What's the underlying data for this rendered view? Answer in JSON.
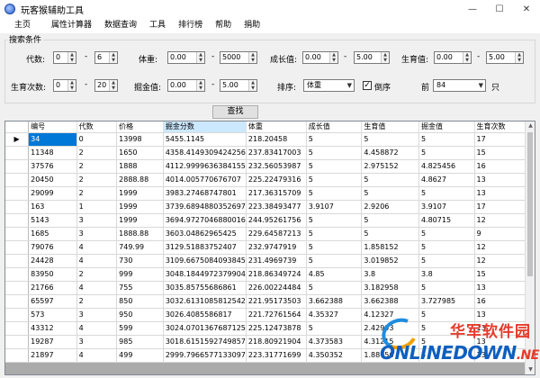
{
  "window": {
    "title": "玩客猴辅助工具",
    "controls": [
      "—",
      "☐",
      "✕"
    ]
  },
  "menu": [
    "主页",
    "属性计算器",
    "数据查询",
    "工具",
    "排行榜",
    "帮助",
    "捐助"
  ],
  "search": {
    "group_title": "搜索条件",
    "row1": [
      {
        "label": "代数:",
        "min": "0",
        "max": "6"
      },
      {
        "label": "体重:",
        "min": "0.00",
        "max": "5000"
      },
      {
        "label": "成长值:",
        "min": "0.00",
        "max": "5.00"
      },
      {
        "label": "生育值:",
        "min": "0.00",
        "max": "5.00"
      }
    ],
    "row2": [
      {
        "label": "生育次数:",
        "min": "0",
        "max": "20"
      },
      {
        "label": "掘金值:",
        "min": "0.00",
        "max": "5.00"
      }
    ],
    "dash": "-",
    "sort_label": "排序:",
    "sort_value": "体重",
    "reverse_label": "倒序",
    "reverse_checked": "✓",
    "top_label": "前",
    "top_value": "84",
    "top_unit": "只",
    "query_button": "查找"
  },
  "table": {
    "columns": [
      "编号",
      "代数",
      "价格",
      "掘金分数",
      "体重",
      "成长值",
      "生育值",
      "掘金值",
      "生育次数"
    ],
    "current_marker": "▶",
    "rows": [
      [
        "34",
        "0",
        "13998",
        "5455.1145",
        "218.20458",
        "5",
        "5",
        "5",
        "17"
      ],
      [
        "11348",
        "2",
        "1650",
        "4358.4149309424256",
        "237.83417003",
        "5",
        "4.458872",
        "5",
        "15"
      ],
      [
        "37576",
        "2",
        "1888",
        "4112.9999636384155",
        "232.56053987",
        "5",
        "2.975152",
        "4.825456",
        "16"
      ],
      [
        "20450",
        "2",
        "2888.88",
        "4014.005770676707",
        "225.22479316",
        "5",
        "5",
        "4.8627",
        "13"
      ],
      [
        "29099",
        "2",
        "1999",
        "3983.27468747801",
        "217.36315709",
        "5",
        "5",
        "5",
        "13"
      ],
      [
        "163",
        "1",
        "1999",
        "3739.6894880352697",
        "223.38493477",
        "3.9107",
        "2.9206",
        "3.9107",
        "17"
      ],
      [
        "5143",
        "3",
        "1999",
        "3694.9727046880016",
        "244.95261756",
        "5",
        "5",
        "4.80715",
        "12"
      ],
      [
        "1685",
        "3",
        "1888.88",
        "3603.04862965425",
        "229.64587213",
        "5",
        "5",
        "5",
        "9"
      ],
      [
        "79076",
        "4",
        "749.99",
        "3129.51883752407",
        "232.9747919",
        "5",
        "1.858152",
        "5",
        "12"
      ],
      [
        "24428",
        "4",
        "730",
        "3109.6675084093845",
        "231.4969739",
        "5",
        "3.019852",
        "5",
        "12"
      ],
      [
        "83950",
        "2",
        "999",
        "3048.1844972379904",
        "218.86349724",
        "4.85",
        "3.8",
        "3.8",
        "15"
      ],
      [
        "21766",
        "4",
        "755",
        "3035.85755686861",
        "226.00224484",
        "5",
        "3.182958",
        "5",
        "13"
      ],
      [
        "65597",
        "2",
        "850",
        "3032.6131085812542",
        "221.95173503",
        "3.662388",
        "3.662388",
        "3.727985",
        "16"
      ],
      [
        "573",
        "3",
        "950",
        "3026.4085586817",
        "221.72761564",
        "4.35327",
        "4.12327",
        "5",
        "13"
      ],
      [
        "43312",
        "4",
        "599",
        "3024.0701367687125",
        "225.12473878",
        "5",
        "2.42993",
        "5",
        "13"
      ],
      [
        "19287",
        "3",
        "985",
        "3018.6151592749857",
        "218.80921904",
        "4.373583",
        "4.31215",
        "5",
        "13"
      ],
      [
        "21897",
        "4",
        "499",
        "2999.7966577133097",
        "223.31771699",
        "4.350352",
        "1.88756",
        "5",
        "13"
      ]
    ]
  },
  "watermark": {
    "top": "华军软件园",
    "bottom_a": "ONLINEDOWN",
    "bottom_dot": ".NET"
  }
}
